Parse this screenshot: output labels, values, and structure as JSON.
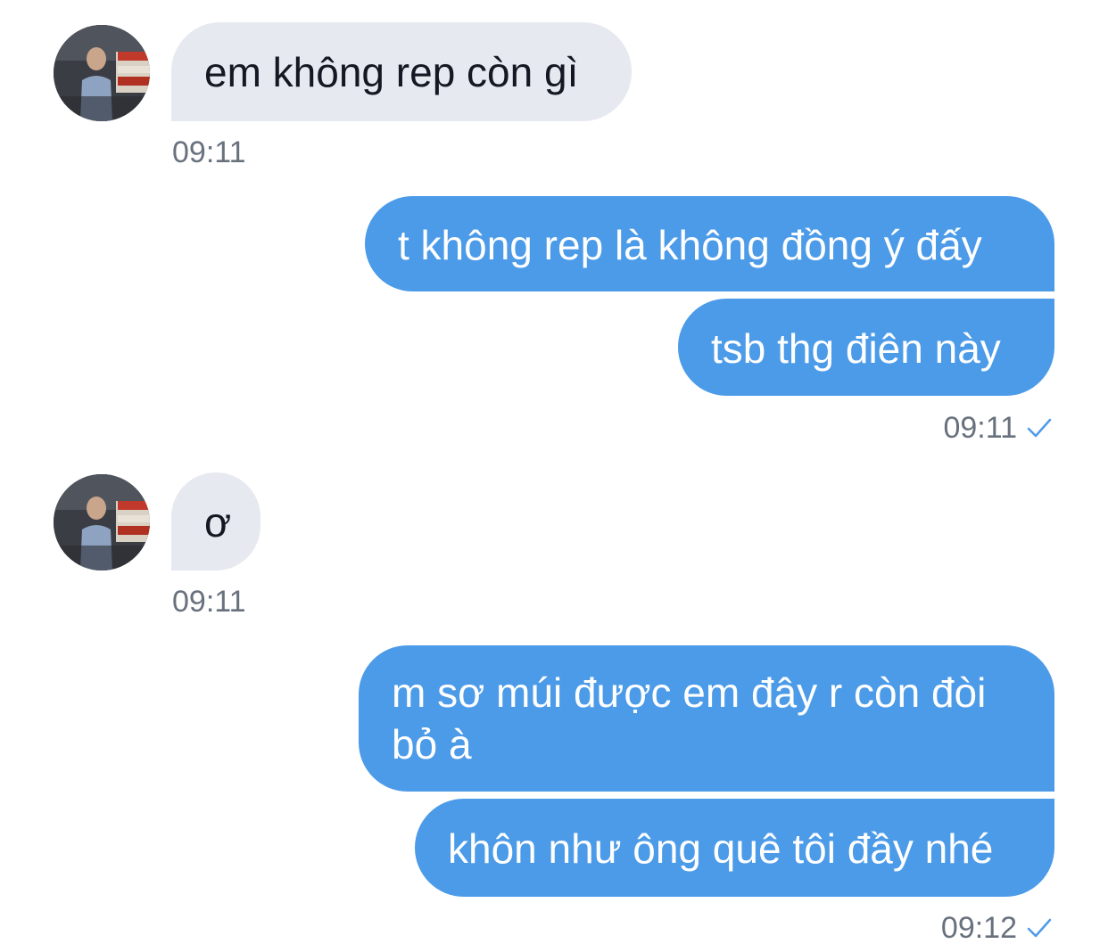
{
  "messages": [
    {
      "direction": "incoming",
      "text": "em không rep còn gì"
    },
    {
      "direction": "incoming_time",
      "time": "09:11"
    },
    {
      "direction": "outgoing",
      "text": "t không rep là không đồng ý đấy"
    },
    {
      "direction": "outgoing",
      "text": "tsb thg điên này"
    },
    {
      "direction": "outgoing_time",
      "time": "09:11",
      "status_icon": "check-icon"
    },
    {
      "direction": "incoming",
      "text": "ơ"
    },
    {
      "direction": "incoming_time",
      "time": "09:11"
    },
    {
      "direction": "outgoing",
      "text": "m sơ múi được em đây r còn đòi bỏ à"
    },
    {
      "direction": "outgoing",
      "text": "khôn như ông quê tôi đầy nhé"
    },
    {
      "direction": "outgoing_time",
      "time": "09:12",
      "status_icon": "check-icon"
    }
  ],
  "colors": {
    "incoming_bubble": "#e6e9ef",
    "outgoing_bubble": "#4c9be8",
    "timestamp_text": "#68717d",
    "check_icon": "#4c9be8"
  }
}
